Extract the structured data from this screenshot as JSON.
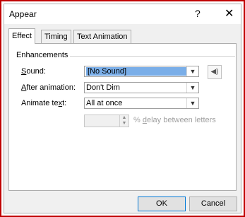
{
  "window": {
    "title": "Appear",
    "help_label": "?",
    "close_label": "✕"
  },
  "tabs": [
    {
      "label": "Effect"
    },
    {
      "label": "Timing"
    },
    {
      "label": "Text Animation"
    }
  ],
  "enhancements": {
    "section_label": "Enhancements",
    "sound": {
      "label_underlined": "S",
      "label_rest": "ound:",
      "value": "[No Sound]"
    },
    "after_animation": {
      "label_underlined": "A",
      "label_rest": "fter animation:",
      "value": "Don't Dim"
    },
    "animate_text": {
      "label_pre": "Animate te",
      "label_underlined": "x",
      "label_rest": "t:",
      "value": "All at once"
    },
    "delay": {
      "value": "",
      "label_pre": "% ",
      "label_underlined": "d",
      "label_rest": "elay between letters"
    }
  },
  "icons": {
    "dropdown": "chevron-down-icon",
    "speaker": "speaker-icon",
    "spinner": "spin-arrows-icon"
  },
  "buttons": {
    "ok": "OK",
    "cancel": "Cancel"
  }
}
